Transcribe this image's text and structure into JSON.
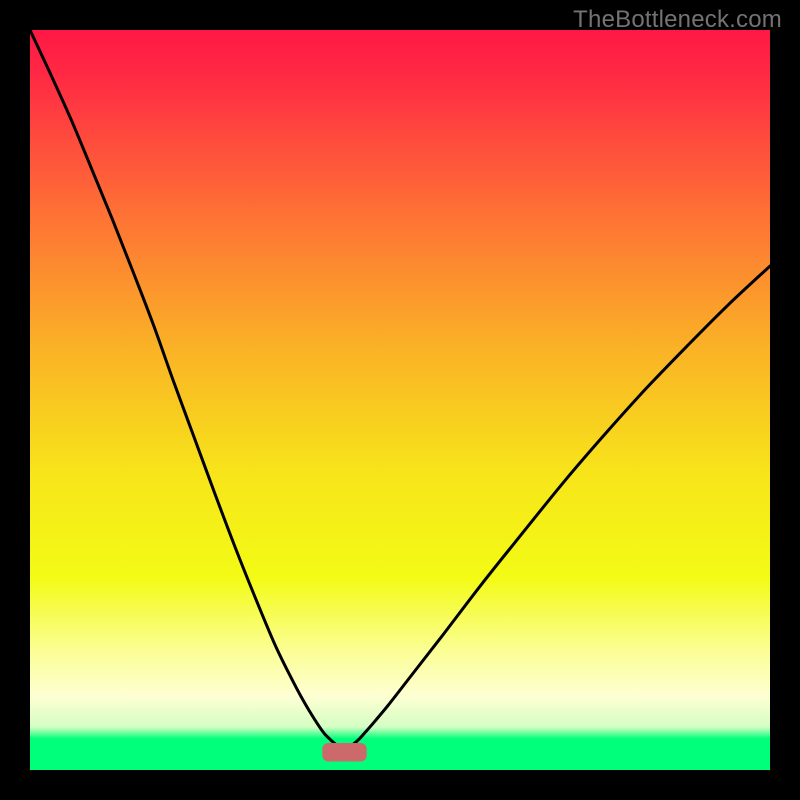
{
  "watermark": "TheBottleneck.com",
  "chart_data": {
    "type": "line",
    "title": "",
    "xlabel": "",
    "ylabel": "",
    "xlim": [
      0,
      100
    ],
    "ylim": [
      0,
      100
    ],
    "grid": false,
    "legend": false,
    "background": {
      "gradient_stops": [
        {
          "pos": 0.0,
          "color": "#ff1844"
        },
        {
          "pos": 0.06,
          "color": "#ff2944"
        },
        {
          "pos": 0.25,
          "color": "#fe7235"
        },
        {
          "pos": 0.43,
          "color": "#fab226"
        },
        {
          "pos": 0.6,
          "color": "#f7e51a"
        },
        {
          "pos": 0.74,
          "color": "#f3fb15"
        },
        {
          "pos": 0.84,
          "color": "#fbfe96"
        },
        {
          "pos": 0.9,
          "color": "#feffd2"
        },
        {
          "pos": 0.942,
          "color": "#d4fec4"
        },
        {
          "pos": 0.958,
          "color": "#00ff7a"
        },
        {
          "pos": 1.0,
          "color": "#00ff7a"
        }
      ],
      "note": "Vertical gradient red→orange→yellow→pale→green representing bottleneck severity from high (top) to low (bottom)."
    },
    "marker": {
      "center_x": 42.5,
      "y": 2.4,
      "width": 6.0,
      "height": 2.5,
      "color": "#cc6a6b",
      "shape": "rounded-rect"
    },
    "series": [
      {
        "name": "left-curve",
        "x": [
          0.0,
          2.8,
          5.6,
          8.3,
          11.1,
          13.9,
          16.7,
          19.4,
          22.2,
          25.0,
          27.8,
          30.6,
          33.3,
          36.1,
          37.8,
          39.0,
          39.8,
          40.6,
          41.4
        ],
        "y": [
          100.0,
          94.0,
          87.8,
          81.3,
          74.5,
          67.4,
          60.1,
          52.5,
          44.9,
          37.3,
          29.9,
          22.9,
          16.5,
          10.9,
          7.9,
          6.0,
          4.9,
          4.1,
          3.4
        ]
      },
      {
        "name": "right-curve",
        "x": [
          43.6,
          44.5,
          45.4,
          46.7,
          48.6,
          51.4,
          55.6,
          61.1,
          66.7,
          72.2,
          77.8,
          83.3,
          88.9,
          94.4,
          100.0
        ],
        "y": [
          3.4,
          4.2,
          5.2,
          6.7,
          9.0,
          12.6,
          18.0,
          25.2,
          32.2,
          39.0,
          45.5,
          51.6,
          57.4,
          62.9,
          68.1
        ]
      }
    ]
  }
}
